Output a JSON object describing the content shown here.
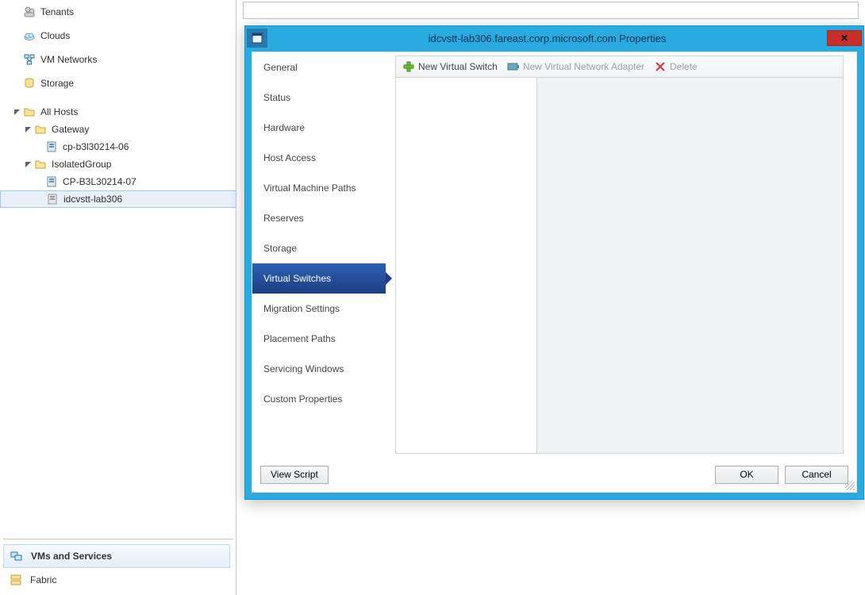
{
  "nav": {
    "tree": [
      {
        "label": "Tenants",
        "icon": "tenants",
        "indent": 0,
        "expander": "none"
      },
      {
        "label": "Clouds",
        "icon": "cloud",
        "indent": 0,
        "expander": "none"
      },
      {
        "label": "VM Networks",
        "icon": "vmnet",
        "indent": 0,
        "expander": "none"
      },
      {
        "label": "Storage",
        "icon": "storage",
        "indent": 0,
        "expander": "none"
      },
      {
        "label": "All Hosts",
        "icon": "folder",
        "indent": 1,
        "expander": "open"
      },
      {
        "label": "Gateway",
        "icon": "folder",
        "indent": 2,
        "expander": "open"
      },
      {
        "label": "cp-b3l30214-06",
        "icon": "server",
        "indent": 3,
        "expander": "none"
      },
      {
        "label": "IsolatedGroup",
        "icon": "folder",
        "indent": 2,
        "expander": "open"
      },
      {
        "label": "CP-B3L30214-07",
        "icon": "server",
        "indent": 3,
        "expander": "none"
      },
      {
        "label": "idcvstt-lab306",
        "icon": "server-gray",
        "indent": 3,
        "expander": "none",
        "selected": true
      }
    ],
    "bottom": [
      {
        "label": "VMs and Services",
        "icon": "vms",
        "active": true
      },
      {
        "label": "Fabric",
        "icon": "fabric",
        "active": false
      }
    ]
  },
  "dialog": {
    "title": "idcvstt-lab306.fareast.corp.microsoft.com Properties",
    "close_glyph": "✕",
    "side": [
      "General",
      "Status",
      "Hardware",
      "Host Access",
      "Virtual Machine Paths",
      "Reserves",
      "Storage",
      "Virtual Switches",
      "Migration Settings",
      "Placement Paths",
      "Servicing Windows",
      "Custom Properties"
    ],
    "side_selected": 7,
    "toolbar": {
      "new_vswitch": "New Virtual Switch",
      "new_vnic": "New Virtual Network Adapter",
      "delete": "Delete"
    },
    "footer": {
      "view_script": "View Script",
      "ok": "OK",
      "cancel": "Cancel"
    }
  }
}
